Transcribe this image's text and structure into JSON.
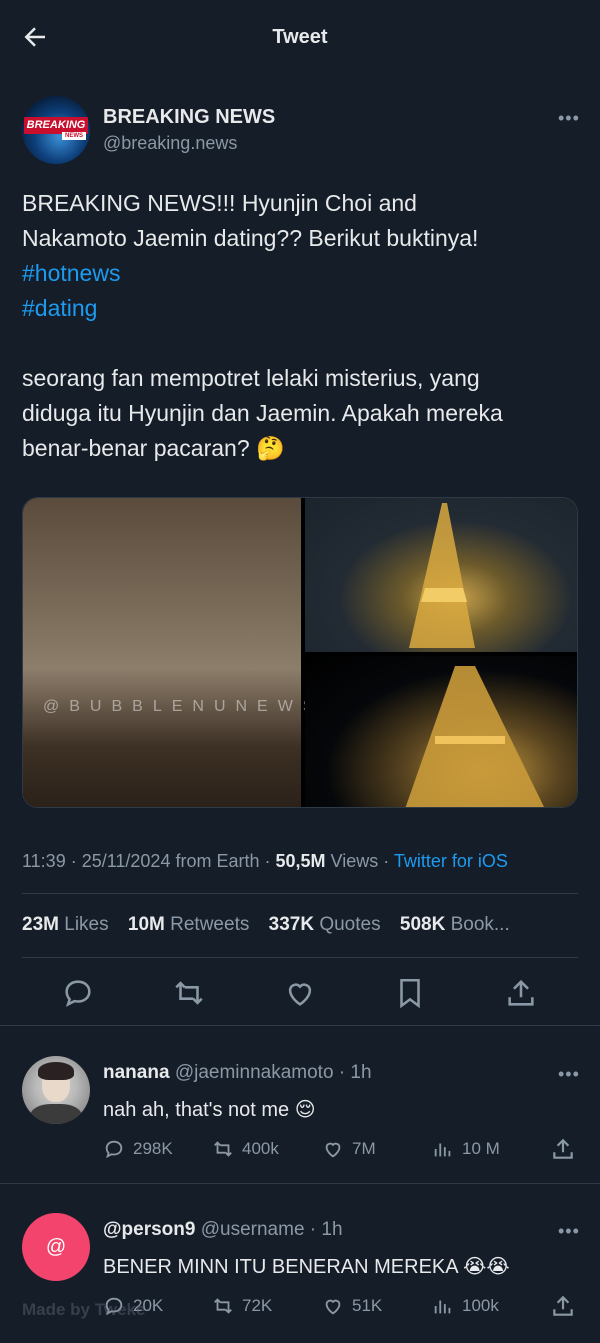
{
  "header": {
    "title": "Tweet"
  },
  "author": {
    "name": "BREAKING NEWS",
    "handle": "@breaking.news",
    "avatar_badge": "BREAKING",
    "avatar_sub": "NEWS"
  },
  "tweet": {
    "line1": "BREAKING NEWS!!! Hyunjin Choi and",
    "line2": "Nakamoto Jaemin dating?? Berikut buktinya!",
    "hashtag1": "#hotnews",
    "hashtag2": "#dating",
    "line3": "seorang fan mempotret lelaki misterius, yang",
    "line4": "diduga itu Hyunjin dan Jaemin. Apakah mereka",
    "line5": "benar-benar pacaran? 🤔"
  },
  "media": {
    "watermark": "@BUBBLENUNEWS"
  },
  "meta": {
    "time": "11:39 · 25/11/2024 from Earth · ",
    "views_count": "50,5M",
    "views_label": " Views · ",
    "client": "Twitter for iOS"
  },
  "stats": {
    "likes_count": "23M",
    "likes_label": "Likes",
    "retweets_count": "10M",
    "retweets_label": "Retweets",
    "quotes_count": "337K",
    "quotes_label": "Quotes",
    "bookmarks_count": "508K",
    "bookmarks_label": "Book..."
  },
  "replies": [
    {
      "name": "nanana",
      "handle": "@jaeminnakamoto · 1h",
      "text": "nah ah, that's not me 😌",
      "replies": "298K",
      "retweets": "400k",
      "likes": "7M",
      "views": "10 M"
    },
    {
      "name": "@person9",
      "handle": "@username · 1h",
      "avatar_glyph": "@",
      "text": "BENER MINN ITU BENERAN MEREKA 😭😭",
      "replies": "20K",
      "retweets": "72K",
      "likes": "51K",
      "views": "100k"
    }
  ],
  "watermark": "Made by Tweke"
}
